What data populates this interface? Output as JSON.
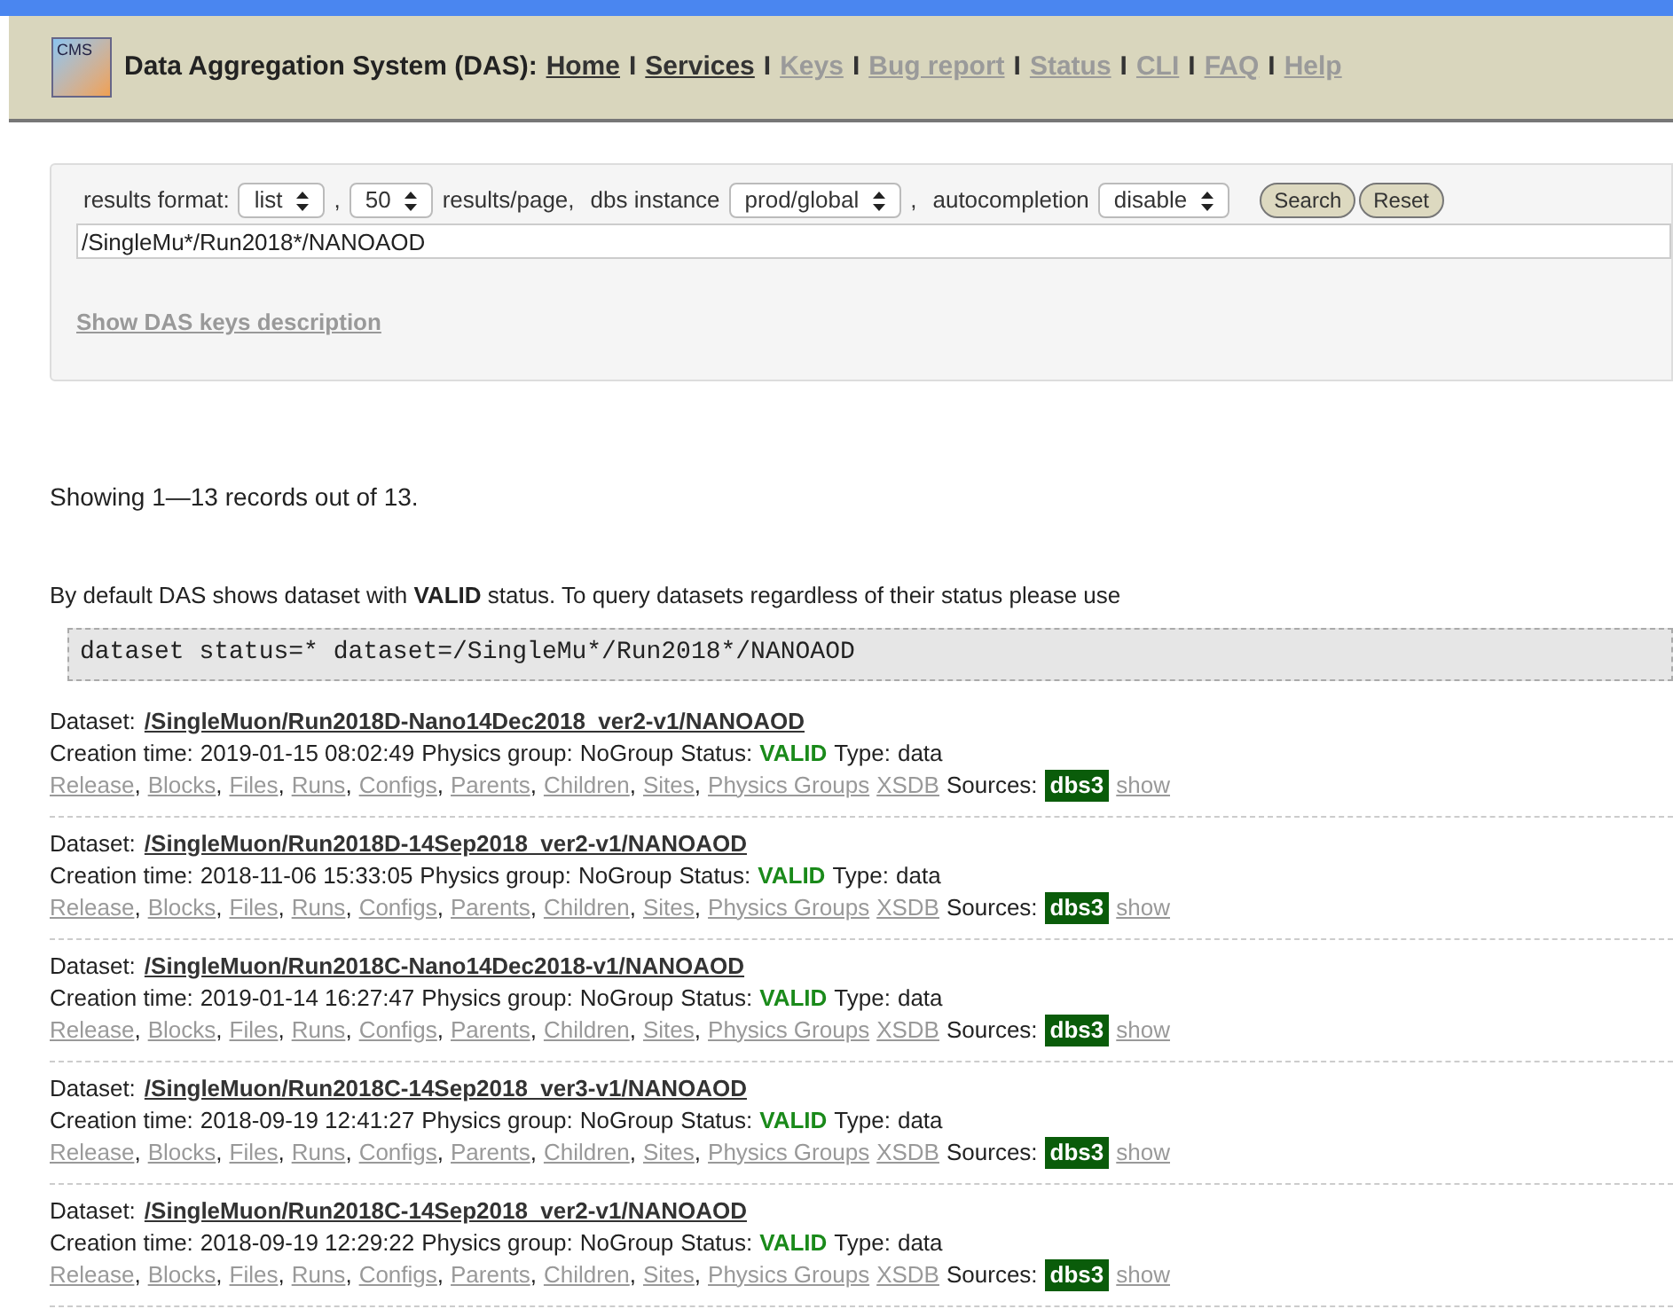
{
  "header": {
    "logo_text": "CMS",
    "title": "Data Aggregation System (DAS):",
    "nav": [
      {
        "label": "Home",
        "disabled": false,
        "separator": "I"
      },
      {
        "label": "Services",
        "disabled": false,
        "separator": "I"
      },
      {
        "label": "Keys",
        "disabled": true,
        "separator": "I"
      },
      {
        "label": "Bug report",
        "disabled": true,
        "separator": "I"
      },
      {
        "label": "Status",
        "disabled": true,
        "separator": "I"
      },
      {
        "label": "CLI",
        "disabled": true,
        "separator": "I"
      },
      {
        "label": "FAQ",
        "disabled": true,
        "separator": "I"
      },
      {
        "label": "Help",
        "disabled": true
      }
    ]
  },
  "form": {
    "controls": [
      {
        "label": "results format:",
        "value": "list",
        "after": ","
      },
      {
        "value": "50",
        "after": "results/page,"
      },
      {
        "label": "dbs instance",
        "value": "prod/global",
        "after": ","
      },
      {
        "label": "autocompletion",
        "value": "disable"
      }
    ],
    "buttons": [
      "Search",
      "Reset"
    ],
    "query": "/SingleMu*/Run2018*/NANOAOD",
    "keys_link": "Show DAS keys description"
  },
  "summary": "Showing 1—13 records out of 13.",
  "notice": "By default DAS shows dataset with **VALID** status. To query datasets regardless of their status please use",
  "example_query": "dataset status=* dataset=/SingleMu*/Run2018*/NANOAOD",
  "datasets": [
    {
      "label": "Dataset:",
      "name": "/SingleMuon/Run2018D-Nano14Dec2018_ver2-v1/NANOAOD",
      "creation_label": "Creation time:",
      "creation": "2019-01-15 08:02:49",
      "group_label": "Physics group:",
      "group": "NoGroup",
      "status_label": "Status:",
      "status": "VALID",
      "type_label": "Type:",
      "type": "data",
      "links": [
        {
          "label": "Release",
          "separator": ","
        },
        {
          "label": "Blocks",
          "separator": ","
        },
        {
          "label": "Files",
          "separator": ","
        },
        {
          "label": "Runs",
          "separator": ","
        },
        {
          "label": "Configs",
          "separator": ","
        },
        {
          "label": "Parents",
          "separator": ","
        },
        {
          "label": "Children",
          "separator": ","
        },
        {
          "label": "Sites",
          "separator": ","
        },
        {
          "label": "Physics Groups"
        },
        {
          "label": "XSDB"
        }
      ],
      "sources_label": "Sources:",
      "source": "dbs3",
      "show_link": "show"
    },
    {
      "label": "Dataset:",
      "name": "/SingleMuon/Run2018D-14Sep2018_ver2-v1/NANOAOD",
      "creation_label": "Creation time:",
      "creation": "2018-11-06 15:33:05",
      "group_label": "Physics group:",
      "group": "NoGroup",
      "status_label": "Status:",
      "status": "VALID",
      "type_label": "Type:",
      "type": "data",
      "links": [
        {
          "label": "Release",
          "separator": ","
        },
        {
          "label": "Blocks",
          "separator": ","
        },
        {
          "label": "Files",
          "separator": ","
        },
        {
          "label": "Runs",
          "separator": ","
        },
        {
          "label": "Configs",
          "separator": ","
        },
        {
          "label": "Parents",
          "separator": ","
        },
        {
          "label": "Children",
          "separator": ","
        },
        {
          "label": "Sites",
          "separator": ","
        },
        {
          "label": "Physics Groups"
        },
        {
          "label": "XSDB"
        }
      ],
      "sources_label": "Sources:",
      "source": "dbs3",
      "show_link": "show"
    },
    {
      "label": "Dataset:",
      "name": "/SingleMuon/Run2018C-Nano14Dec2018-v1/NANOAOD",
      "creation_label": "Creation time:",
      "creation": "2019-01-14 16:27:47",
      "group_label": "Physics group:",
      "group": "NoGroup",
      "status_label": "Status:",
      "status": "VALID",
      "type_label": "Type:",
      "type": "data",
      "links": [
        {
          "label": "Release",
          "separator": ","
        },
        {
          "label": "Blocks",
          "separator": ","
        },
        {
          "label": "Files",
          "separator": ","
        },
        {
          "label": "Runs",
          "separator": ","
        },
        {
          "label": "Configs",
          "separator": ","
        },
        {
          "label": "Parents",
          "separator": ","
        },
        {
          "label": "Children",
          "separator": ","
        },
        {
          "label": "Sites",
          "separator": ","
        },
        {
          "label": "Physics Groups"
        },
        {
          "label": "XSDB"
        }
      ],
      "sources_label": "Sources:",
      "source": "dbs3",
      "show_link": "show"
    },
    {
      "label": "Dataset:",
      "name": "/SingleMuon/Run2018C-14Sep2018_ver3-v1/NANOAOD",
      "creation_label": "Creation time:",
      "creation": "2018-09-19 12:41:27",
      "group_label": "Physics group:",
      "group": "NoGroup",
      "status_label": "Status:",
      "status": "VALID",
      "type_label": "Type:",
      "type": "data",
      "links": [
        {
          "label": "Release",
          "separator": ","
        },
        {
          "label": "Blocks",
          "separator": ","
        },
        {
          "label": "Files",
          "separator": ","
        },
        {
          "label": "Runs",
          "separator": ","
        },
        {
          "label": "Configs",
          "separator": ","
        },
        {
          "label": "Parents",
          "separator": ","
        },
        {
          "label": "Children",
          "separator": ","
        },
        {
          "label": "Sites",
          "separator": ","
        },
        {
          "label": "Physics Groups"
        },
        {
          "label": "XSDB"
        }
      ],
      "sources_label": "Sources:",
      "source": "dbs3",
      "show_link": "show"
    },
    {
      "label": "Dataset:",
      "name": "/SingleMuon/Run2018C-14Sep2018_ver2-v1/NANOAOD",
      "creation_label": "Creation time:",
      "creation": "2018-09-19 12:29:22",
      "group_label": "Physics group:",
      "group": "NoGroup",
      "status_label": "Status:",
      "status": "VALID",
      "type_label": "Type:",
      "type": "data",
      "links": [
        {
          "label": "Release",
          "separator": ","
        },
        {
          "label": "Blocks",
          "separator": ","
        },
        {
          "label": "Files",
          "separator": ","
        },
        {
          "label": "Runs",
          "separator": ","
        },
        {
          "label": "Configs",
          "separator": ","
        },
        {
          "label": "Parents",
          "separator": ","
        },
        {
          "label": "Children",
          "separator": ","
        },
        {
          "label": "Sites",
          "separator": ","
        },
        {
          "label": "Physics Groups"
        },
        {
          "label": "XSDB"
        }
      ],
      "sources_label": "Sources:",
      "source": "dbs3",
      "show_link": "show"
    }
  ]
}
